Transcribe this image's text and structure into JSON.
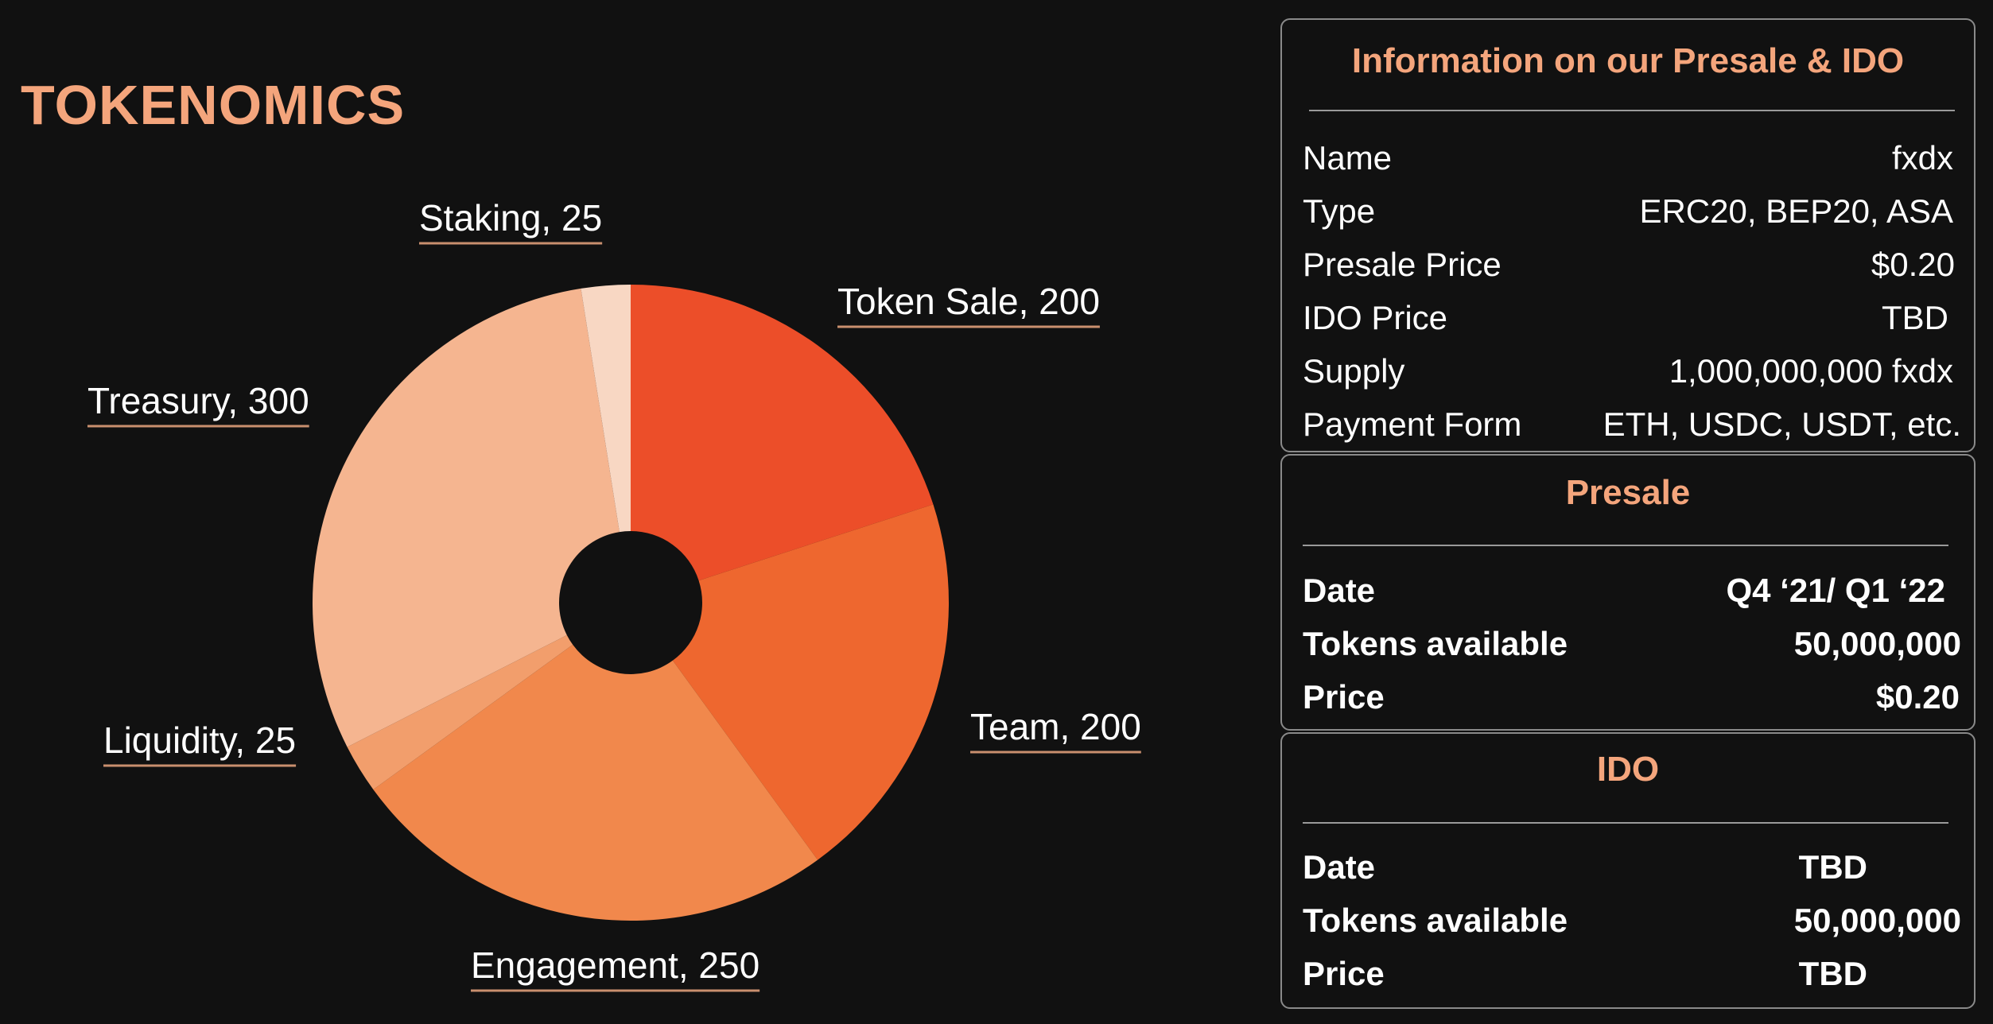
{
  "title": "TOKENOMICS",
  "chart_data": {
    "type": "pie",
    "donut": true,
    "slices": [
      {
        "label": "Token Sale",
        "value": 200,
        "caption": "Token Sale, 200",
        "color": "#EC4E29"
      },
      {
        "label": "Team",
        "value": 200,
        "caption": "Team, 200",
        "color": "#EE672F"
      },
      {
        "label": "Engagement",
        "value": 250,
        "caption": "Engagement, 250",
        "color": "#F1884C"
      },
      {
        "label": "Liquidity",
        "value": 25,
        "caption": "Liquidity, 25",
        "color": "#F29E6C"
      },
      {
        "label": "Treasury",
        "value": 300,
        "caption": "Treasury, 300",
        "color": "#F5B590"
      },
      {
        "label": "Staking",
        "value": 25,
        "caption": "Staking, 25",
        "color": "#F8D7C3"
      }
    ]
  },
  "presale_info": {
    "title": "Information on our Presale & IDO",
    "rows": [
      {
        "key": "Name",
        "value": "fxdx"
      },
      {
        "key": "Type",
        "value": "ERC20, BEP20, ASA"
      },
      {
        "key": "Presale Price",
        "value": "$0.20"
      },
      {
        "key": "IDO Price",
        "value": "TBD"
      },
      {
        "key": "Supply",
        "value": "1,000,000,000 fxdx"
      },
      {
        "key": "Payment Form",
        "value": "ETH, USDC, USDT, etc."
      }
    ]
  },
  "presale": {
    "title": "Presale",
    "rows": [
      {
        "key": "Date",
        "value": "Q4 ‘21/ Q1 ‘22"
      },
      {
        "key": "Tokens available",
        "value": "50,000,000"
      },
      {
        "key": "Price",
        "value": "$0.20"
      }
    ]
  },
  "ido": {
    "title": "IDO",
    "rows": [
      {
        "key": "Date",
        "value": "TBD"
      },
      {
        "key": "Tokens available",
        "value": "50,000,000"
      },
      {
        "key": "Price",
        "value": "TBD"
      }
    ]
  },
  "colors": {
    "accent": "#F4A57C",
    "background": "#111111",
    "label_underline": "#C98F6E"
  }
}
